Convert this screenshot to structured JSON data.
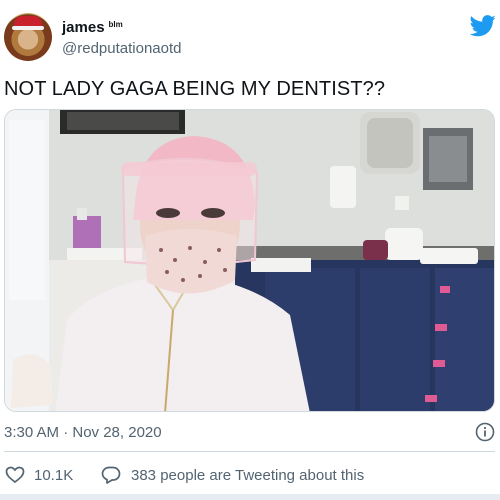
{
  "user": {
    "display_name": "james",
    "name_suffix": "blm",
    "handle": "@redputationaotd",
    "avatar_icon": "profile-photo-santa-hat"
  },
  "tweet": {
    "text": "NOT LADY GAGA BEING MY DENTIST??",
    "media_description_icon": "photo-dentist-in-pink-mask-and-face-shield",
    "timestamp": "3:30 AM · Nov 28, 2020"
  },
  "actions": {
    "like_count": "10.1K",
    "reply_text": "383 people are Tweeting about this"
  },
  "icons": {
    "brand": "twitter-bird-icon",
    "info": "info-icon",
    "like": "heart-icon",
    "reply": "speech-bubble-icon"
  },
  "colors": {
    "brand_blue": "#1d9bf0",
    "secondary_text": "#536471",
    "primary_text": "#0f1419",
    "divider": "#cfd9de"
  }
}
